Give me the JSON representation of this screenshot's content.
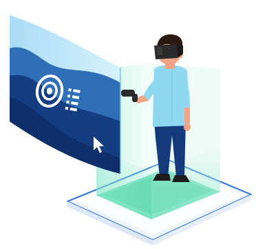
{
  "illustration": {
    "subject": "vr-user-with-virtual-screen",
    "icons": [
      "target-icon",
      "list-icon",
      "cursor-icon"
    ]
  },
  "colors": {
    "background": "#ffffff",
    "screen_light": "#bfe6f8",
    "screen_mid": "#2f6fb8",
    "screen_dark": "#153e82",
    "platform_glow": "#5fe0b5",
    "platform_outline": "#2b6fe0",
    "shirt": "#8fd8f2",
    "trousers": "#143a7c",
    "skin": "#f0a385",
    "hair": "#2a1a12",
    "headset": "#2b2b2b"
  }
}
